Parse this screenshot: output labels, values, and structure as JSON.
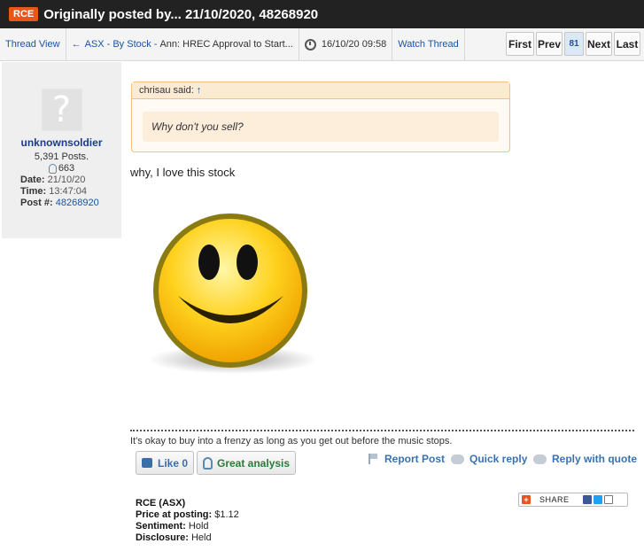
{
  "titlebar": {
    "ticker": "RCE",
    "title": "Originally posted by... 21/10/2020, 48268920"
  },
  "navbar": {
    "thread_view": "Thread View",
    "back_arrow": "←",
    "forum": "ASX - By Stock",
    "separator": "-",
    "thread_title": "Ann: HREC Approval to Start...",
    "thread_date": "16/10/20 09:58",
    "watch_thread": "Watch Thread"
  },
  "pager": {
    "first": "First",
    "prev": "Prev",
    "current": "81",
    "next": "Next",
    "last": "Last"
  },
  "author": {
    "avatar_glyph": "?",
    "username": "unknownsoldier",
    "posts": "5,391 Posts.",
    "likes": "663",
    "date_label": "Date:",
    "date": "21/10/20",
    "time_label": "Time:",
    "time": "13:47:04",
    "post_label": "Post #:",
    "post_id": "48268920"
  },
  "quote": {
    "header": "chrisau said:",
    "arrow": "↑",
    "text": "Why don't you sell?"
  },
  "post": {
    "text": "why, I love this stock"
  },
  "signature": "It's okay to buy into a frenzy as long as you get out before the music stops.",
  "actions": {
    "like": "Like 0",
    "great_analysis": "Great analysis",
    "report": "Report Post",
    "quick_reply": "Quick reply",
    "reply_quote": "Reply with quote"
  },
  "stock": {
    "ticker_line": "RCE (ASX)",
    "price_label": "Price at posting:",
    "price": "$1.12",
    "sentiment_label": "Sentiment:",
    "sentiment": "Hold",
    "disclosure_label": "Disclosure:",
    "disclosure": "Held"
  },
  "share": {
    "plus": "+",
    "label": "SHARE"
  },
  "colors": {
    "accent": "#e8561c",
    "link": "#1a54a0",
    "quote_border": "#f2c37c"
  }
}
